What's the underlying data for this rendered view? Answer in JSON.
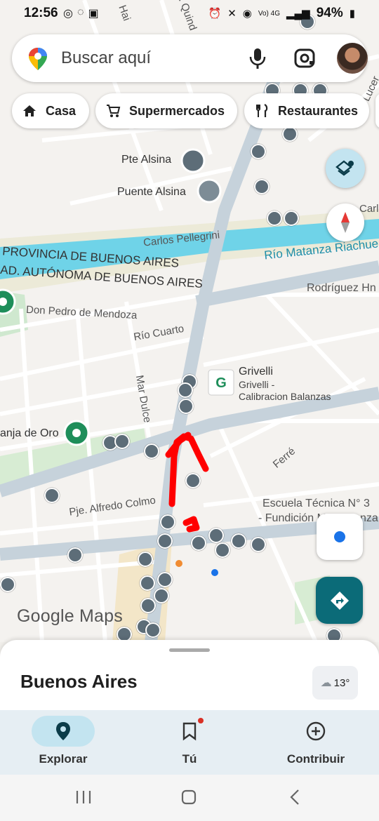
{
  "status_bar": {
    "time": "12:56",
    "battery": "94%",
    "network": "Vo) 4G"
  },
  "search": {
    "placeholder": "Buscar aquí"
  },
  "chips": [
    {
      "label": "Casa",
      "icon": "home-icon"
    },
    {
      "label": "Supermercados",
      "icon": "cart-icon"
    },
    {
      "label": "Restaurantes",
      "icon": "fork-knife-icon"
    }
  ],
  "map_labels": {
    "pte_alsina": "Pte Alsina",
    "puente_alsina": "Puente Alsina",
    "carlos_pellegrini": "Carlos Pellegrini",
    "carl": "Carl",
    "rio_matanza": "Río Matanza Riachue",
    "provincia": "PROVINCIA DE BUENOS AIRES",
    "ciudad": "AD. AUTÓNOMA DE BUENOS AIRES",
    "rodriguez": "Rodríguez Hn",
    "don_pedro": "Don Pedro de Mendoza",
    "rio_cuarto": "Río Cuarto",
    "grivelli": "Grivelli",
    "grivelli_sub": "Grivelli -",
    "grivelli_sub2": "Calibracion Balanzas",
    "mar_dulce": "Mar Dulce",
    "granja": "anja de Oro",
    "ferre": "Ferré",
    "alfredo": "Pje. Alfredo Colmo",
    "escuela": "Escuela Técnica N° 3",
    "fundicion": "- Fundición M",
    "fundicion2": "nza",
    "quind": "F. Quind",
    "lucero": "Lucer",
    "hai": "Hai"
  },
  "google_logo": "Google Maps",
  "sheet": {
    "city": "Buenos Aires",
    "temperature": "13°"
  },
  "bottom_nav": [
    {
      "label": "Explorar",
      "icon": "explore-pin-icon",
      "active": true
    },
    {
      "label": "Tú",
      "icon": "bookmark-icon",
      "active": false
    },
    {
      "label": "Contribuir",
      "icon": "add-circle-icon",
      "active": false
    }
  ],
  "colors": {
    "river": "#6fd3e8",
    "road": "#c6d2db",
    "accent": "#0b6b78",
    "annotation": "#ff0000",
    "nav_bg": "#e6eef3",
    "nav_active": "#c3e4f0"
  }
}
